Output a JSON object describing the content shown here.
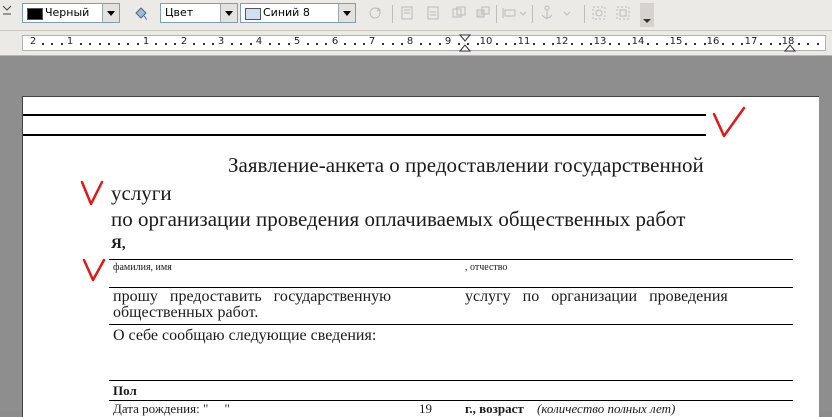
{
  "toolbar": {
    "line_color": {
      "label": "Черный",
      "color": "#000000"
    },
    "fill_mode": {
      "label": "Цвет"
    },
    "fill_color": {
      "label": "Синий 8",
      "color": "#cfe0f2"
    }
  },
  "ruler": {
    "numbers": [
      "2",
      "1",
      "1",
      "2",
      "3",
      "4",
      "5",
      "6",
      "7",
      "8",
      "9",
      "10",
      "11",
      "12",
      "13",
      "14",
      "15",
      "16",
      "17",
      "18"
    ]
  },
  "document": {
    "title_line1": "Заявление-анкета о предоставлении государственной",
    "title_line2": "услуги",
    "title_line3": "по организации проведения оплачиваемых общественных работ",
    "ya": "Я,",
    "name_caption": "фамилия, имя",
    "patronymic_caption": ", отчество",
    "request_left_line1": "прошу   предоставить   государственную",
    "request_left_line2": "общественных работ.",
    "request_right_line1": "услугу   по   организации   проведения",
    "about": "О себе сообщаю следующие сведения:",
    "gender": "Пол",
    "birth_label": "Дата рождения: \"     \"",
    "birth_year": "19",
    "age_label": "г., возраст",
    "age_note": "(количество полных лет)"
  },
  "annotations": {
    "check_color": "#e01818"
  }
}
